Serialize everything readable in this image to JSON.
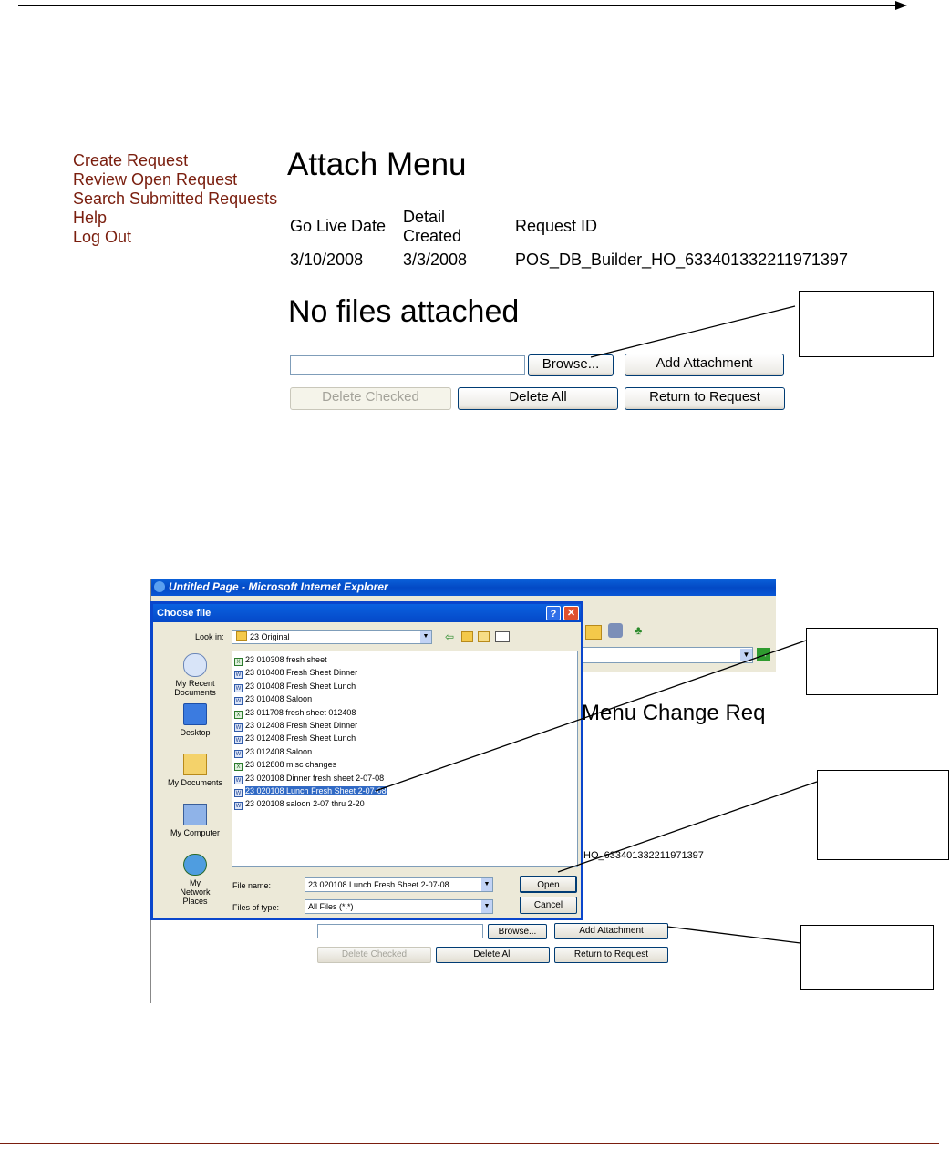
{
  "nav": {
    "items": [
      "Create Request",
      "Review Open Request",
      "Search Submitted Requests",
      "Help",
      "Log Out"
    ]
  },
  "page": {
    "title": "Attach Menu",
    "status": "No files attached"
  },
  "request_table": {
    "headers": {
      "go_live": "Go Live Date",
      "detail_1": "Detail",
      "detail_2": "Created",
      "request_id": "Request ID"
    },
    "values": {
      "go_live": "3/10/2008",
      "detail": "3/3/2008",
      "request_id": "POS_DB_Builder_HO_633401332211971397"
    }
  },
  "buttons": {
    "browse": "Browse...",
    "add_attachment": "Add Attachment",
    "delete_checked": "Delete Checked",
    "delete_all": "Delete All",
    "return": "Return to Request"
  },
  "screenshot": {
    "ie_title": "Untitled Page - Microsoft Internet Explorer",
    "bg_heading": "Menu Change Req",
    "bg_request_id": "HO_633401332211971397",
    "bg_buttons": {
      "browse": "Browse...",
      "add_attachment": "Add Attachment",
      "delete_checked": "Delete Checked",
      "delete_all": "Delete All",
      "return": "Return to Request"
    },
    "dialog": {
      "title": "Choose file",
      "help_glyph": "?",
      "close_glyph": "✕",
      "look_in_label": "Look in:",
      "look_in_value": "23 Original",
      "places": [
        {
          "label": "My Recent Documents",
          "icon": "recent-documents-icon"
        },
        {
          "label": "Desktop",
          "icon": "desktop-icon"
        },
        {
          "label": "My Documents",
          "icon": "my-documents-icon"
        },
        {
          "label": "My Computer",
          "icon": "my-computer-icon"
        },
        {
          "label": "My Network Places",
          "icon": "network-places-icon"
        }
      ],
      "files": [
        {
          "name": "23 010308 fresh sheet",
          "type": "excel"
        },
        {
          "name": "23 010408 Fresh Sheet Dinner",
          "type": "word"
        },
        {
          "name": "23 010408 Fresh Sheet Lunch",
          "type": "word"
        },
        {
          "name": "23 010408 Saloon",
          "type": "word"
        },
        {
          "name": "23 011708 fresh sheet 012408",
          "type": "excel"
        },
        {
          "name": "23 012408 Fresh Sheet Dinner",
          "type": "word"
        },
        {
          "name": "23 012408 Fresh Sheet Lunch",
          "type": "word"
        },
        {
          "name": "23 012408 Saloon",
          "type": "word"
        },
        {
          "name": "23 012808 misc changes",
          "type": "excel"
        },
        {
          "name": "23 020108 Dinner fresh sheet 2-07-08",
          "type": "word"
        },
        {
          "name": "23 020108 Lunch Fresh Sheet 2-07-08",
          "type": "word",
          "selected": true
        },
        {
          "name": "23 020108 saloon 2-07 thru 2-20",
          "type": "word"
        }
      ],
      "file_name_label": "File name:",
      "file_name_value": "23 020108 Lunch Fresh Sheet 2-07-08",
      "file_type_label": "Files of type:",
      "file_type_value": "All Files (*.*)",
      "open_label": "Open",
      "cancel_label": "Cancel"
    }
  },
  "colors": {
    "nav_link": "#7a1e0e",
    "xp_blue": "#0a46cc",
    "selection": "#316ac5",
    "footer_rule": "#7a1e0e"
  }
}
